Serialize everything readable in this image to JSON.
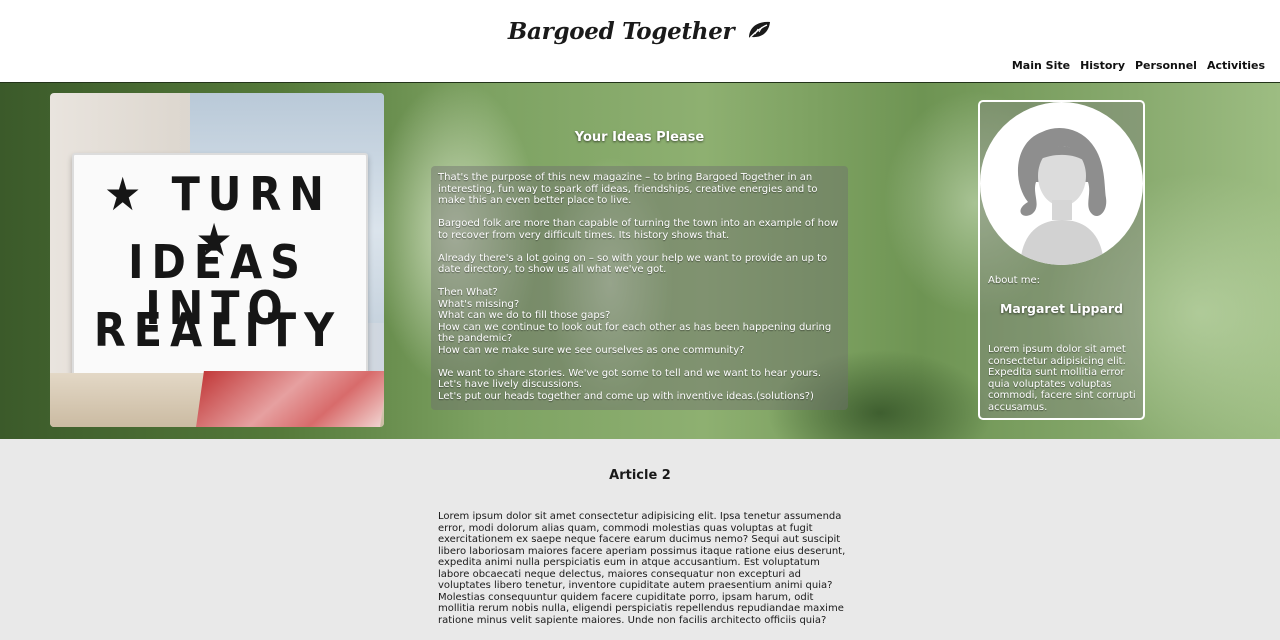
{
  "header": {
    "brand": "Bargoed Together",
    "brand_icon": "leaf-icon",
    "nav": [
      {
        "label": "Main Site"
      },
      {
        "label": "History"
      },
      {
        "label": "Personnel"
      },
      {
        "label": "Activities"
      }
    ]
  },
  "hero": {
    "photo": {
      "lines": [
        "★ TURN ★",
        "IDEAS INTO",
        "REALITY"
      ]
    },
    "article": {
      "title": "Your Ideas Please",
      "paragraphs": [
        "That's the purpose of this new magazine – to bring Bargoed Together in an interesting, fun way to spark off ideas, friendships, creative energies and to make this an even better place to live.",
        "Bargoed folk are more than capable of turning the town into an example of how to recover from very difficult times. Its history shows that.",
        "Already there's a lot going on – so with your help we want to provide an up to date directory, to show us all what we've got.",
        "Then What?\nWhat's missing?\nWhat can we do to fill those gaps?\nHow can we continue to look out for each other as has been happening during the pandemic?\nHow can we make sure we see ourselves as one community?",
        "We want to share stories. We've got some to tell and we want to hear yours.\nLet's have lively discussions.\nLet's put our heads together and come up with inventive ideas.(solutions?)"
      ]
    },
    "profile": {
      "avatar_icon": "person-silhouette-icon",
      "about_label": "About me:",
      "name": "Margaret Lippard",
      "bio": "Lorem ipsum dolor sit amet consectetur adipisicing elit. Expedita sunt mollitia error quia voluptates voluptas commodi, facere sint corrupti accusamus."
    }
  },
  "article2": {
    "title": "Article 2",
    "body": "Lorem ipsum dolor sit amet consectetur adipisicing elit. Ipsa tenetur assumenda error, modi dolorum alias quam, commodi molestias quas voluptas at fugit exercitationem ex saepe neque facere earum ducimus nemo? Sequi aut suscipit libero laboriosam maiores facere aperiam possimus itaque ratione eius deserunt, expedita animi nulla perspiciatis eum in atque accusantium. Est voluptatum labore obcaecati neque delectus, maiores consequatur non excepturi ad voluptates libero tenetur, inventore cupiditate autem praesentium animi quia? Molestias consequuntur quidem facere cupiditate porro, ipsam harum, odit mollitia rerum nobis nulla, eligendi perspiciatis repellendus repudiandae maxime ratione minus velit sapiente maiores. Unde non facilis architecto officiis quia?"
  }
}
